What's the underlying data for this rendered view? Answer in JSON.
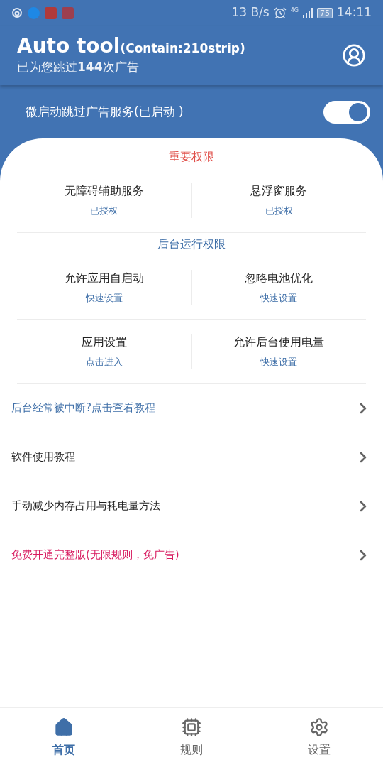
{
  "status_bar": {
    "network_speed": "13 B/s",
    "network_type": "4G",
    "battery": "75",
    "time": "14:11"
  },
  "header": {
    "title": "Auto tool",
    "title_note": "(Contain:210strip)",
    "subtitle": "已为您跳过**144**次广告"
  },
  "service": {
    "label": "微启动跳过广告服务(已启动 )",
    "on": true
  },
  "sections": [
    {
      "title": "重要权限",
      "kind": "important",
      "rows": [
        [
          {
            "name": "无障碍辅助服务",
            "action": "已授权"
          },
          {
            "name": "悬浮窗服务",
            "action": "已授权"
          }
        ]
      ]
    },
    {
      "title": "后台运行权限",
      "kind": "background",
      "rows": [
        [
          {
            "name": "允许应用自启动",
            "action": "快速设置"
          },
          {
            "name": "忽略电池优化",
            "action": "快速设置"
          }
        ],
        [
          {
            "name": "应用设置",
            "action": "点击进入"
          },
          {
            "name": "允许后台使用电量",
            "action": "快速设置"
          }
        ]
      ]
    }
  ],
  "links": [
    {
      "label": "后台经常被中断?点击查看教程",
      "color": "#3f6fa8"
    },
    {
      "label": "软件使用教程",
      "color": "#1f1f1f"
    },
    {
      "label": "手动减少内存占用与耗电量方法",
      "color": "#1f1f1f"
    },
    {
      "label": "免费开通完整版(无限规则，免广告)",
      "color": "#d81b60"
    }
  ],
  "nav": [
    {
      "label": "首页",
      "kind": "home",
      "selected": true
    },
    {
      "label": "规则",
      "kind": "rules",
      "selected": false
    },
    {
      "label": "设置",
      "kind": "settings",
      "selected": false
    }
  ]
}
